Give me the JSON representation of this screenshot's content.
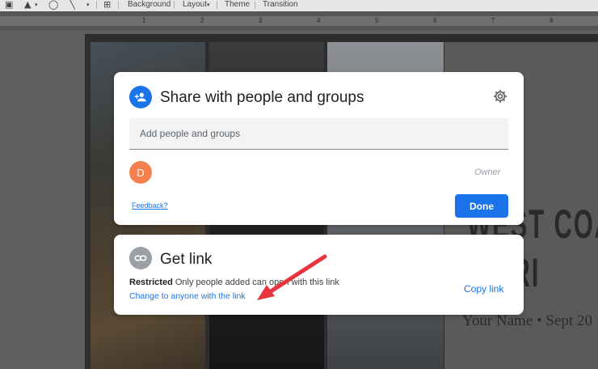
{
  "toolbar": {
    "background_label": "Background",
    "layout_label": "Layout",
    "theme_label": "Theme",
    "transition_label": "Transition"
  },
  "ruler": {
    "numbers": [
      "1",
      "2",
      "3",
      "4",
      "5",
      "6",
      "7",
      "8"
    ]
  },
  "slide": {
    "title_line1": "WEST COA",
    "title_line2": "D TRI",
    "subtitle": "Your Name • Sept 20"
  },
  "share_dialog": {
    "title": "Share with people and groups",
    "input_placeholder": "Add people and groups",
    "person_initial": "D",
    "person_role": "Owner",
    "feedback_label": "Feedback?",
    "done_label": "Done",
    "colors": {
      "accent": "#1a73e8",
      "avatar": "#f5804d"
    }
  },
  "link_dialog": {
    "title": "Get link",
    "restricted_label": "Restricted",
    "restricted_text": "Only people added can open with this link",
    "change_label": "Change to anyone with the link",
    "copy_label": "Copy link"
  },
  "annotation": {
    "arrow_color": "#e8343f"
  },
  "icons": {
    "share": "person-add-icon",
    "settings": "gear-icon",
    "link": "link-icon"
  }
}
